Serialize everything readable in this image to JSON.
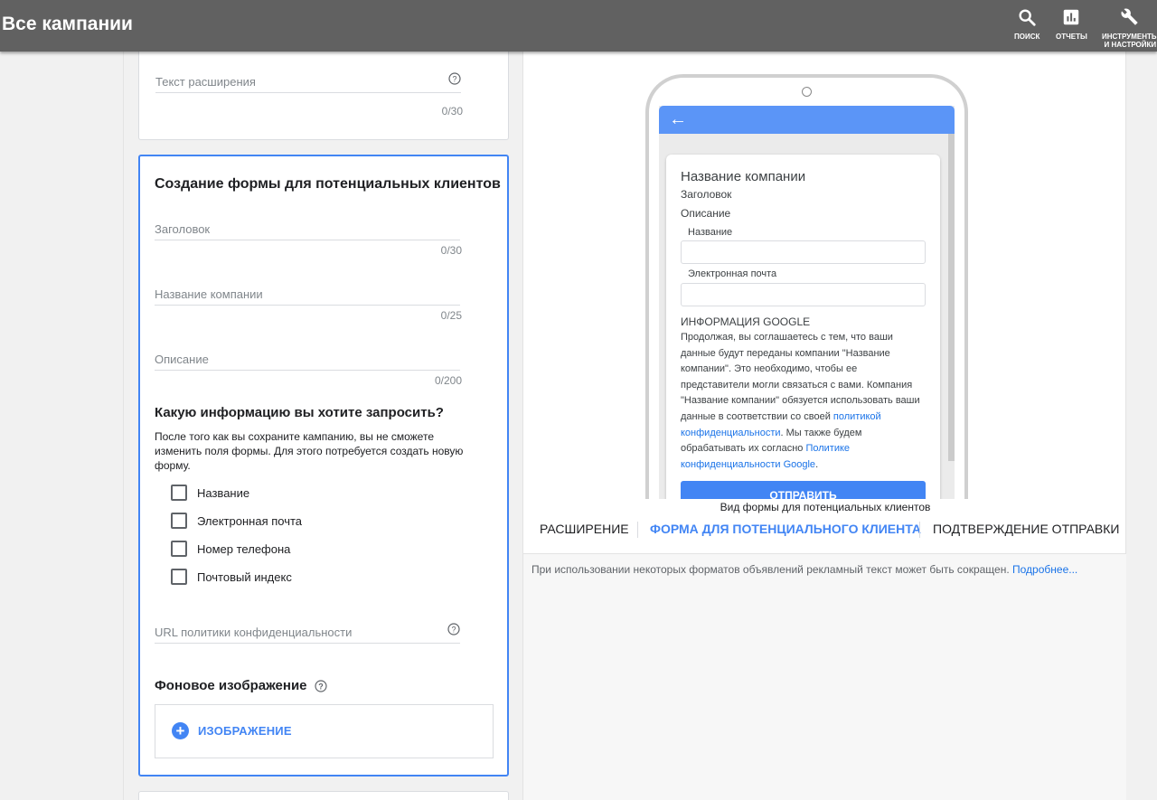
{
  "header": {
    "title": "Все кампании",
    "actions": [
      {
        "icon": "search-icon",
        "label": "ПОИСК"
      },
      {
        "icon": "reports-icon",
        "label": "ОТЧЕТЫ"
      },
      {
        "icon": "wrench-icon",
        "label": "ИНСТРУМЕНТЫ\nИ НАСТРОЙКИ"
      }
    ]
  },
  "extension_card": {
    "field_placeholder": "Текст расширения",
    "counter": "0/30"
  },
  "lead_form": {
    "title": "Создание формы для потенциальных клиентов",
    "headline": {
      "placeholder": "Заголовок",
      "counter": "0/30"
    },
    "company": {
      "placeholder": "Название компании",
      "counter": "0/25"
    },
    "description": {
      "placeholder": "Описание",
      "counter": "0/200"
    },
    "question_title": "Какую информацию вы хотите запросить?",
    "question_note": "После того как вы сохраните кампанию, вы не сможете изменить поля формы. Для этого потребуется создать новую форму.",
    "options": [
      "Название",
      "Электронная почта",
      "Номер телефона",
      "Почтовый индекс"
    ],
    "privacy_url_placeholder": "URL политики конфиденциальности",
    "bg_image_title": "Фоновое изображение",
    "image_button": "ИЗОБРАЖЕНИЕ"
  },
  "preview": {
    "company_name": "Название компании",
    "headline": "Заголовок",
    "description": "Описание",
    "field_name_label": "Название",
    "field_email_label": "Электронная почта",
    "google_info_title": "ИНФОРМАЦИЯ GOOGLE",
    "google_text_1": "Продолжая, вы соглашаетесь с тем, что ваши данные будут переданы компании \"Название компании\". Это необходимо, чтобы ее представители могли связаться с вами. Компания \"Название компании\" обязуется использовать ваши данные в соответствии со своей ",
    "google_link_1": "политикой конфиденциальности",
    "google_text_2": ". Мы также будем обрабатывать их согласно ",
    "google_link_2": "Политике конфиденциальности Google",
    "google_text_3": ".",
    "submit_button": "ОТПРАВИТЬ",
    "caption": "Вид формы для потенциальных клиентов"
  },
  "tabs": [
    {
      "label": "РАСШИРЕНИЕ",
      "active": false
    },
    {
      "label": "ФОРМА ДЛЯ ПОТЕНЦИАЛЬНОГО КЛИЕНТА",
      "active": true
    },
    {
      "label": "ПОДТВЕРЖДЕНИЕ ОТПРАВКИ",
      "active": false
    }
  ],
  "disclaimer": {
    "text": "При использовании некоторых форматов объявлений рекламный текст может быть сокращен. ",
    "link": "Подробнее..."
  },
  "colors": {
    "accent": "#4285f4",
    "header_bg": "#616161",
    "link": "#1a73e8"
  }
}
